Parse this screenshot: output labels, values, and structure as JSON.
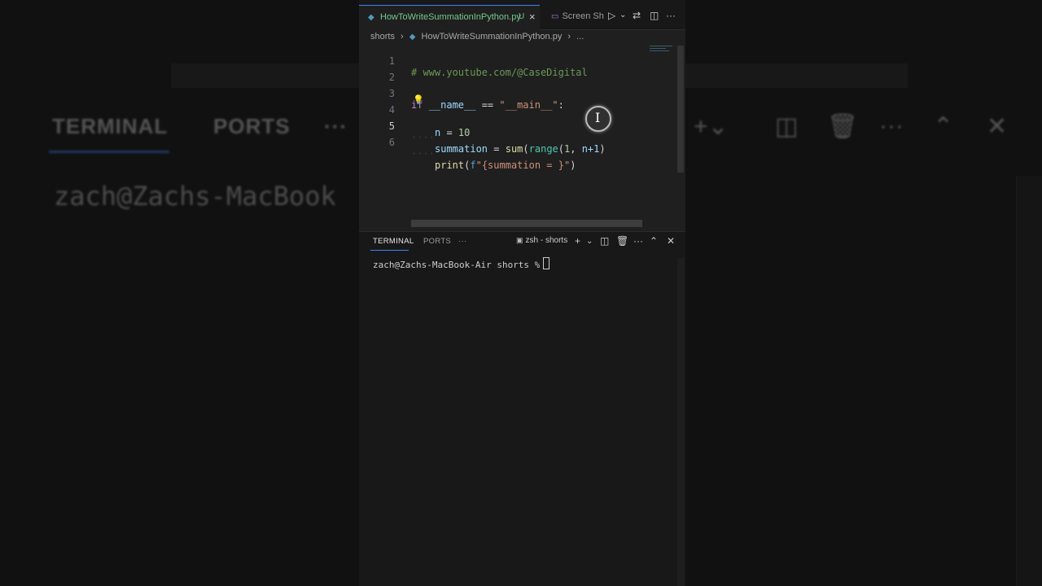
{
  "background": {
    "tabs": [
      "TERMINAL",
      "PORTS",
      "···"
    ],
    "prompt": "zach@Zachs-MacBook"
  },
  "editor_tabs": {
    "active_filename": "HowToWriteSummationInPython.py",
    "active_status": "U",
    "second_tab": "Screen Sh",
    "icons": [
      "python-file-icon",
      "close-icon",
      "screen-icon",
      "run-icon",
      "chevron-down-icon",
      "source-control-icon",
      "split-editor-icon",
      "more-icon"
    ]
  },
  "breadcrumb": {
    "folder": "shorts",
    "file": "HowToWriteSummationInPython.py",
    "more": "..."
  },
  "code": {
    "line_numbers": [
      "1",
      "2",
      "3",
      "4",
      "5",
      "6"
    ],
    "line1": "# www.youtube.com/@CaseDigital",
    "l3_if": "if",
    "l3_name": "__name__",
    "l3_eq": " == ",
    "l3_main": "\"__main__\"",
    "l3_colon": ":",
    "l4_n": "n",
    "l4_eq": " = ",
    "l4_num": "10",
    "l5_var": "summation",
    "l5_eq": " = ",
    "l5_sum": "sum",
    "l5_p1": "(",
    "l5_range": "range",
    "l5_p2": "(",
    "l5_one": "1",
    "l5_comma": ", ",
    "l5_arg": "n+1",
    "l5_close": ")",
    "l6_print": "print",
    "l6_p": "(",
    "l6_f": "f",
    "l6_str": "\"{summation = }\"",
    "l6_close": ")"
  },
  "terminal": {
    "tabs": [
      "TERMINAL",
      "PORTS",
      "···"
    ],
    "shell_label": "zsh - shorts",
    "prompt": "zach@Zachs-MacBook-Air shorts %"
  },
  "colors": {
    "accent": "#3b82f6",
    "untracked": "#73c991",
    "comment": "#6a9955",
    "keyword": "#c586c0",
    "string": "#ce9178"
  }
}
